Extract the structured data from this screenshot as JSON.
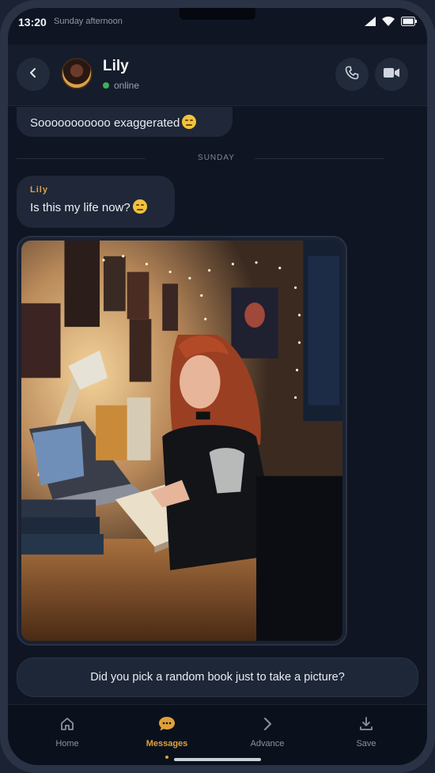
{
  "status_bar": {
    "time": "13:20",
    "subtitle": "Sunday afternoon",
    "icons": [
      "signal-icon",
      "wifi-icon",
      "battery-icon"
    ]
  },
  "header": {
    "contact_name": "Lily",
    "contact_status": "online",
    "icons": [
      "back-arrow-icon",
      "phone-icon",
      "video-camera-icon"
    ]
  },
  "chat": {
    "previous_message": "Sooooooooooo exaggerated",
    "day_divider": "SUNDAY",
    "messages": [
      {
        "sender": "Lily",
        "text": "Is this my life now?"
      }
    ],
    "photo_alt": "Photo of a red-haired girl studying at a desk with a lamp, laptop, books and fairy lights",
    "outgoing_message": "Did you pick a random book just to take a picture?"
  },
  "nav": {
    "items": [
      {
        "label": "Home",
        "icon": "home-icon",
        "active": false
      },
      {
        "label": "Messages",
        "icon": "chat-bubble-icon",
        "active": true
      },
      {
        "label": "Advance",
        "icon": "chevron-right-icon",
        "active": false
      },
      {
        "label": "Save",
        "icon": "download-icon",
        "active": false
      }
    ]
  },
  "colors": {
    "accent": "#e0a03a",
    "background": "#0f1522",
    "bubble": "#1f2738",
    "online": "#3fae5a"
  }
}
